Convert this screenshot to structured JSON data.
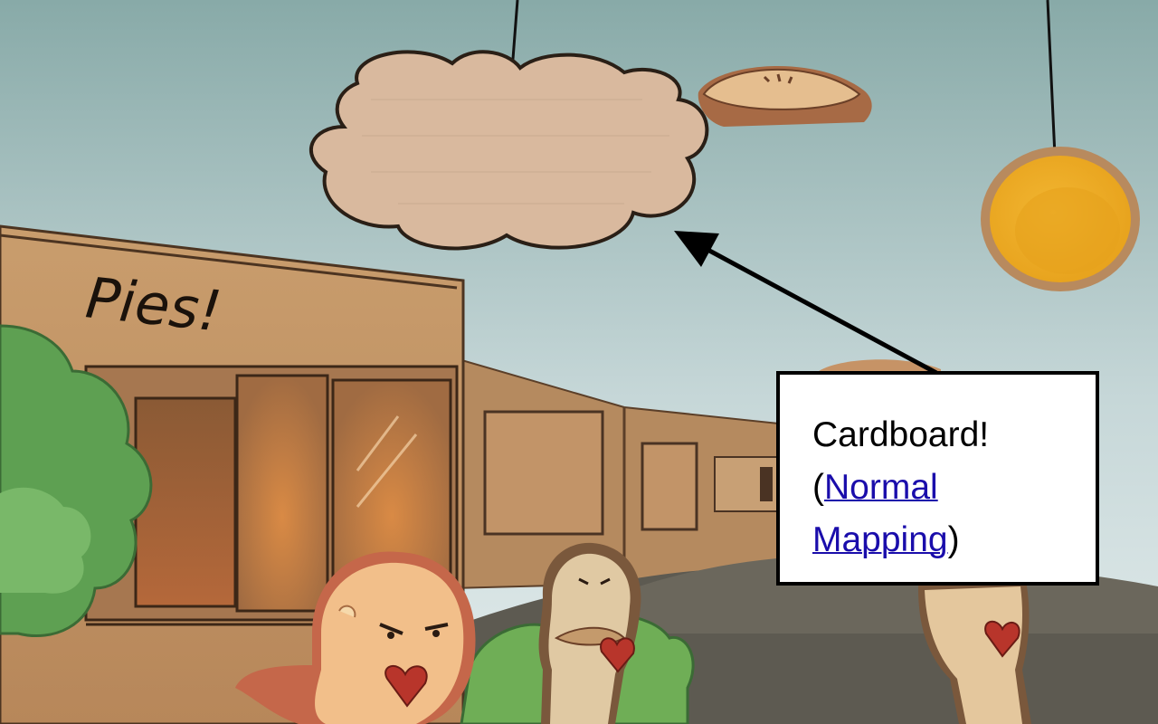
{
  "scene": {
    "shop_sign": "Pies!",
    "sky_top": "#8fb0ad",
    "sky_bottom": "#d7e3e3",
    "cardboard_color": "#c79a6b",
    "ground_color": "#5f5a4f"
  },
  "callout": {
    "line1": "Cardboard!",
    "open_paren": "(",
    "link_word1": "Normal",
    "link_word2": "Mapping",
    "close_paren": ")",
    "link_color": "#1a0dab"
  }
}
